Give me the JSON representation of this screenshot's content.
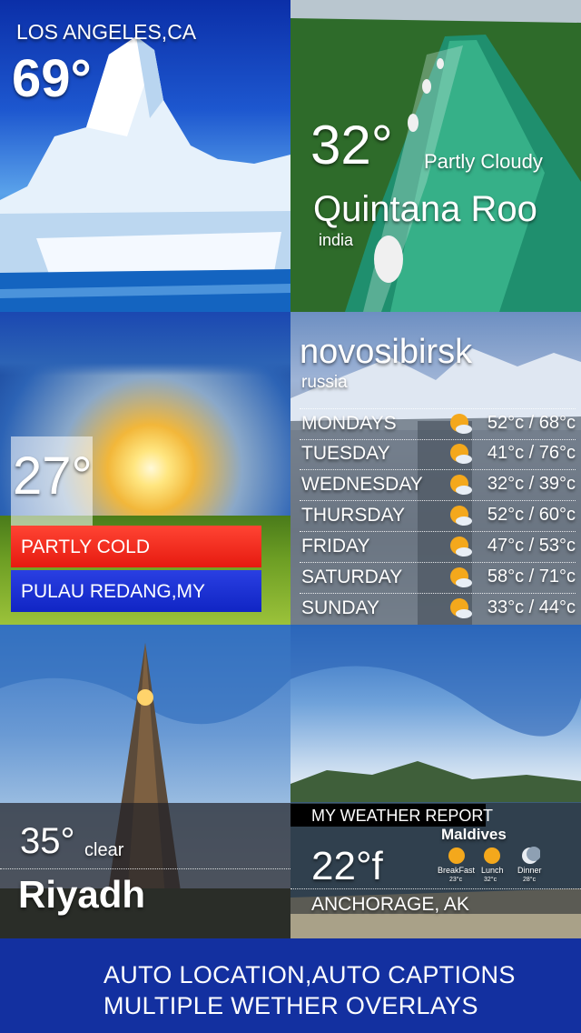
{
  "tiles": {
    "la": {
      "city": "LOS ANGELES,CA",
      "temp": "69°"
    },
    "quintana": {
      "temp": "32°",
      "condition": "Partly Cloudy",
      "city": "Quintana Roo",
      "country": "india"
    },
    "redang": {
      "temp": "27°",
      "condition": "PARTLY COLD",
      "city": "PULAU REDANG,MY"
    },
    "novosibirsk": {
      "city": "novosibirsk",
      "country": "russia",
      "days": [
        {
          "day": "MONDAYS",
          "temps": "52°c / 68°c",
          "icon": "partly-sunny-icon"
        },
        {
          "day": "TUESDAY",
          "temps": "41°c / 76°c",
          "icon": "partly-sunny-icon"
        },
        {
          "day": "WEDNESDAY",
          "temps": "32°c / 39°c",
          "icon": "partly-sunny-icon"
        },
        {
          "day": "THURSDAY",
          "temps": "52°c / 60°c",
          "icon": "partly-sunny-icon"
        },
        {
          "day": "FRIDAY",
          "temps": "47°c / 53°c",
          "icon": "partly-sunny-icon"
        },
        {
          "day": "SATURDAY",
          "temps": "58°c / 71°c",
          "icon": "partly-sunny-icon"
        },
        {
          "day": "SUNDAY",
          "temps": "33°c / 44°c",
          "icon": "partly-sunny-icon"
        }
      ]
    },
    "riyadh": {
      "temp": "35°",
      "condition": "clear",
      "city": "Riyadh"
    },
    "anchorage": {
      "header": "MY WEATHER REPORT",
      "place": "Maldives",
      "temp": "22°f",
      "city": "ANCHORAGE, AK",
      "meals": [
        {
          "label": "BreakFast",
          "temp": "23°c",
          "icon": "sun-icon"
        },
        {
          "label": "Lunch",
          "temp": "32°c",
          "icon": "sun-icon"
        },
        {
          "label": "Dinner",
          "temp": "28°c",
          "icon": "moon-icon"
        }
      ]
    }
  },
  "footer": {
    "line1": "AUTO LOCATION,AUTO CAPTIONS",
    "line2": "MULTIPLE WETHER OVERLAYS"
  },
  "colors": {
    "footer_bg": "#1330a0",
    "red_bar": "#e61a10",
    "blue_bar": "#1025c4",
    "sun": "#f4a81c"
  }
}
